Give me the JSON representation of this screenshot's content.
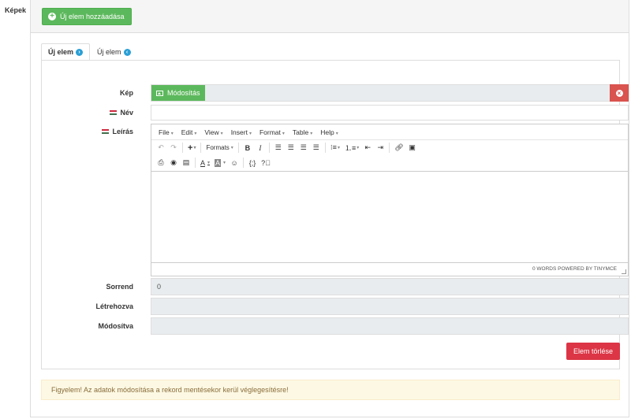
{
  "section": {
    "label": "Képek"
  },
  "header": {
    "new_button_label": "Új elem hozzáadása"
  },
  "tabs": [
    {
      "label": "Új elem",
      "active": true
    },
    {
      "label": "Új elem",
      "active": false
    }
  ],
  "form": {
    "kep_label": "Kép",
    "modify_button_label": "Módosítás",
    "nev_label": "Név",
    "nev_value": "",
    "leiras_label": "Leírás",
    "sorrend_label": "Sorrend",
    "sorrend_value": "0",
    "letrehozva_label": "Létrehozva",
    "letrehozva_value": "",
    "modositva_label": "Módosítva",
    "modositva_value": "",
    "delete_button_label": "Elem törlése"
  },
  "editor": {
    "menus": [
      "File",
      "Edit",
      "View",
      "Insert",
      "Format",
      "Table",
      "Help"
    ],
    "formats_label": "Formats",
    "status_text": "0 WORDS POWERED BY TINYMCE"
  },
  "alert": {
    "text": "Figyelem! Az adatok módosítása a rekord mentésekor kerül véglegesítésre!"
  },
  "colors": {
    "success": "#5cb85c",
    "danger": "#dc3545",
    "accent": "#2a9fd6",
    "warning_bg": "#fcf8e3"
  }
}
